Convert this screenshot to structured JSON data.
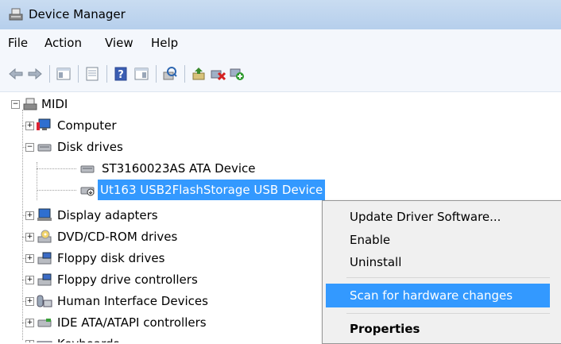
{
  "window": {
    "title": "Device Manager"
  },
  "menu": {
    "items": [
      "File",
      "Action",
      "View",
      "Help"
    ]
  },
  "toolbar": {
    "buttons": [
      "back-arrow-icon",
      "forward-arrow-icon",
      "show-hide-tree-icon",
      "properties-icon",
      "help-icon",
      "view-icon",
      "scan-hardware-icon",
      "update-driver-icon",
      "uninstall-icon",
      "enable-device-icon"
    ]
  },
  "tree": {
    "root": "MIDI",
    "computer": "Computer",
    "disk_drives": "Disk drives",
    "disk_child_1": "ST3160023AS ATA Device",
    "disk_child_2": "Ut163 USB2FlashStorage USB Device",
    "display_adapters": "Display adapters",
    "dvd": "DVD/CD-ROM drives",
    "floppy_disk": "Floppy disk drives",
    "floppy_ctrl": "Floppy drive controllers",
    "hid": "Human Interface Devices",
    "ide": "IDE ATA/ATAPI controllers",
    "keyboards": "Keyboards"
  },
  "context_menu": {
    "update": "Update Driver Software...",
    "enable": "Enable",
    "uninstall": "Uninstall",
    "scan": "Scan for hardware changes",
    "properties": "Properties"
  },
  "colors": {
    "selection": "#3399ff",
    "titlebar": "#b9d1ea"
  }
}
